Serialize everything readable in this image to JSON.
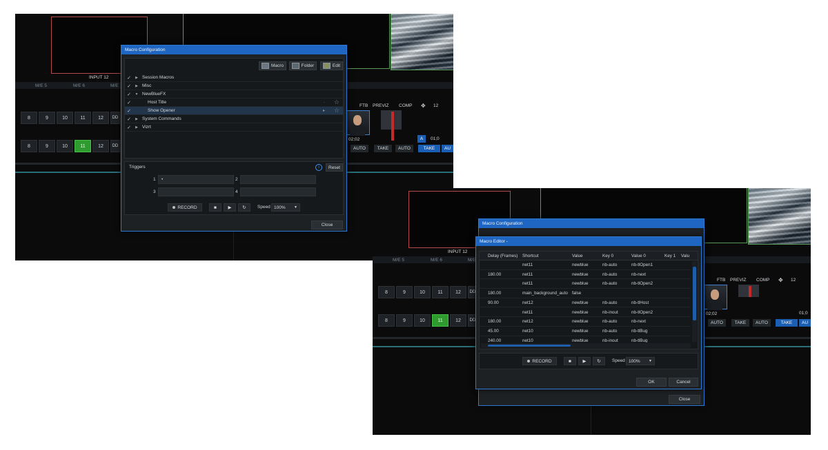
{
  "switcher": {
    "input_label": "INPUT 12",
    "me_labels": [
      "M/E 5",
      "M/E 6",
      "M/E"
    ],
    "row_buttons": [
      "8",
      "9",
      "10",
      "11",
      "12"
    ],
    "dd_label": "DD",
    "dd_sub": "1",
    "active_button": "11",
    "ftb": "FTB",
    "previz": "PREVIZ",
    "comp": "COMP",
    "layer_num": "12",
    "timecode": "02;02",
    "timecode_sub": "01;0",
    "take": "TAKE",
    "auto": "AUTO",
    "a_badge": "A",
    "au_partial": "AU"
  },
  "macro_config": {
    "title": "Macro Configuration",
    "toolbar": {
      "macro": "Macro",
      "folder": "Folder",
      "edit": "Edit"
    },
    "tree": [
      {
        "check": "✓",
        "expander": "▶",
        "label": "Session Macros",
        "indent": 0,
        "selected": false
      },
      {
        "check": "✓",
        "expander": "▶",
        "label": "Misc",
        "indent": 0,
        "selected": false
      },
      {
        "check": "✓",
        "expander": "▼",
        "label": "NewBlueFX",
        "indent": 0,
        "selected": false
      },
      {
        "check": "✓",
        "expander": "",
        "label": "Host Title",
        "indent": 1,
        "selected": false
      },
      {
        "check": "✓",
        "expander": "",
        "label": "Show Opener",
        "indent": 1,
        "selected": true
      },
      {
        "check": "✓",
        "expander": "▶",
        "label": "System Commands",
        "indent": 0,
        "selected": false
      },
      {
        "check": "✓",
        "expander": "▶",
        "label": "Vizrt",
        "indent": 0,
        "selected": false
      }
    ],
    "triggers_title": "Triggers",
    "reset": "Reset",
    "trigger_slots": [
      {
        "num": "1",
        "value": "•"
      },
      {
        "num": "2",
        "value": ""
      },
      {
        "num": "3",
        "value": ""
      },
      {
        "num": "4",
        "value": ""
      }
    ],
    "record": "RECORD",
    "speed_label": "Speed",
    "speed_value": "100%",
    "close": "Close"
  },
  "macro_editor": {
    "title": "Macro Editor -",
    "columns": [
      "Delay (Frames)",
      "Shortcut",
      "Value",
      "Key 0",
      "Value 0",
      "Key 1",
      "Valu"
    ],
    "rows": [
      [
        "",
        "net11",
        "newblue",
        "nb-auto",
        "nb-tlOpen1"
      ],
      [
        "180.00",
        "net11",
        "newblue",
        "nb-auto",
        "nb-next"
      ],
      [
        "",
        "net11",
        "newblue",
        "nb-auto",
        "nb-tlOpen2"
      ],
      [
        "180.00",
        "main_background_auto",
        "false",
        "",
        ""
      ],
      [
        "90.00",
        "net12",
        "newblue",
        "nb-auto",
        "nb-tlHost"
      ],
      [
        "",
        "net11",
        "newblue",
        "nb-inout",
        "nb-tlOpen2"
      ],
      [
        "180.00",
        "net12",
        "newblue",
        "nb-auto",
        "nb-next"
      ],
      [
        "45.00",
        "net10",
        "newblue",
        "nb-auto",
        "nb-tlBug"
      ],
      [
        "240.00",
        "net10",
        "newblue",
        "nb-inout",
        "nb-tlBug"
      ]
    ],
    "record": "RECORD",
    "speed_label": "Speed",
    "speed_value": "100%",
    "ok": "OK",
    "cancel": "Cancel"
  }
}
